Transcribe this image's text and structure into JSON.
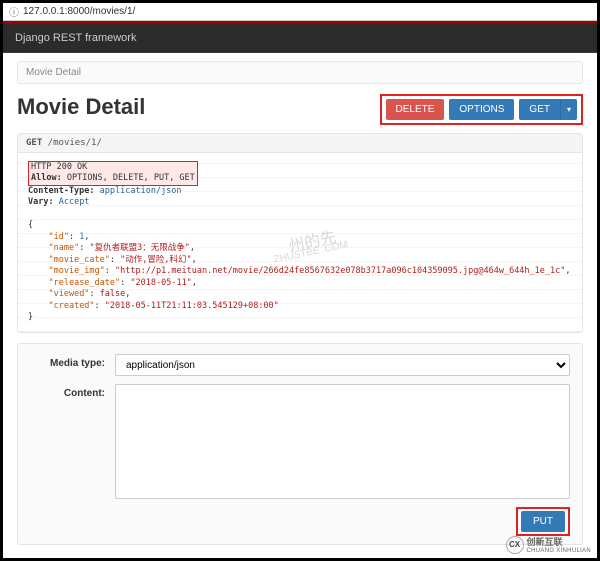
{
  "address_bar": {
    "icon": "ⓘ",
    "url": "127.0.0.1:8000/movies/1/"
  },
  "brand": "Django REST framework",
  "breadcrumb": "Movie Detail",
  "page_title": "Movie Detail",
  "buttons": {
    "delete": "DELETE",
    "options": "OPTIONS",
    "get": "GET",
    "caret": "▾",
    "put": "PUT"
  },
  "request_line": {
    "method": "GET",
    "path": "/movies/1/"
  },
  "response_headers": {
    "status": "HTTP 200 OK",
    "allow_label": "Allow:",
    "allow_value": "OPTIONS, DELETE, PUT, GET",
    "ctype_label": "Content-Type:",
    "ctype_value": "application/json",
    "vary_label": "Vary:",
    "vary_value": "Accept"
  },
  "response_body": {
    "id_k": "\"id\"",
    "id_v": "1",
    "name_k": "\"name\"",
    "name_v": "\"复仇者联盟3：无限战争\"",
    "cate_k": "\"movie_cate\"",
    "cate_v": "\"动作,冒险,科幻\"",
    "img_k": "\"movie_img\"",
    "img_v": "\"http://p1.meituan.net/movie/266d24fe8567632e078b3717a096c104359095.jpg@464w_644h_1e_1c\"",
    "rel_k": "\"release_date\"",
    "rel_v": "\"2018-05-11\"",
    "view_k": "\"viewed\"",
    "view_v": "false",
    "cre_k": "\"created\"",
    "cre_v": "\"2018-05-11T21:11:03.545129+08:00\""
  },
  "form": {
    "media_label": "Media type:",
    "media_value": "application/json",
    "content_label": "Content:"
  },
  "watermark": {
    "a": "州的先",
    "b": "ZHUSTBE .COM"
  },
  "corner": {
    "logo": "CX",
    "line1": "创新互联",
    "line2": "CHUANG XINHULIAN"
  }
}
